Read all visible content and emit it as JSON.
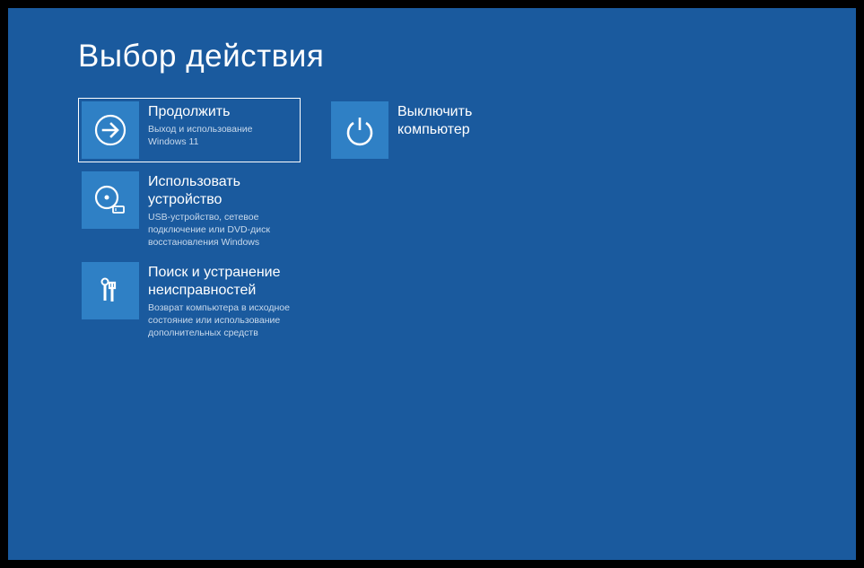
{
  "title": "Выбор действия",
  "tiles": {
    "continue": {
      "title": "Продолжить",
      "sub": "Выход и использование Windows 11"
    },
    "shutdown": {
      "title": "Выключить\nкомпьютер"
    },
    "useDevice": {
      "title": "Использовать\nустройство",
      "sub": "USB-устройство, сетевое подключение или DVD-диск восстановления Windows"
    },
    "troubleshoot": {
      "title": "Поиск и устранение\nнеисправностей",
      "sub": "Возврат компьютера в исходное состояние или использование дополнительных средств"
    }
  }
}
